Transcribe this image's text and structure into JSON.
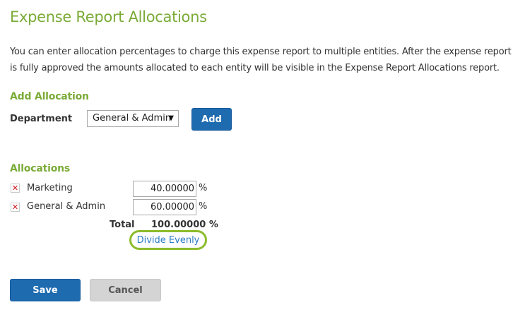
{
  "page": {
    "title": "Expense Report Allocations",
    "description": "You can enter allocation percentages to charge this expense report to multiple entities. After the expense report is fully approved the amounts allocated to each entity will be visible in the Expense Report Allocations report."
  },
  "add_allocation": {
    "heading": "Add Allocation",
    "department_label": "Department",
    "department_selected": "General & Admin",
    "add_label": "Add"
  },
  "allocations": {
    "heading": "Allocations",
    "remove_icon": "x-remove-icon",
    "remove_color": "#d0121b",
    "rows": [
      {
        "label": "Marketing",
        "percent": "40.00000",
        "unit": "%"
      },
      {
        "label": "General & Admin",
        "percent": "60.00000",
        "unit": "%"
      }
    ],
    "total_label": "Total",
    "total_value": "100.00000 %",
    "divide_evenly_label": "Divide Evenly"
  },
  "actions": {
    "save_label": "Save",
    "cancel_label": "Cancel"
  },
  "colors": {
    "accent_green": "#7bab38",
    "primary_blue": "#1e6bb0",
    "link_blue": "#2a7bc4",
    "highlight_green": "#8dbb2a"
  }
}
